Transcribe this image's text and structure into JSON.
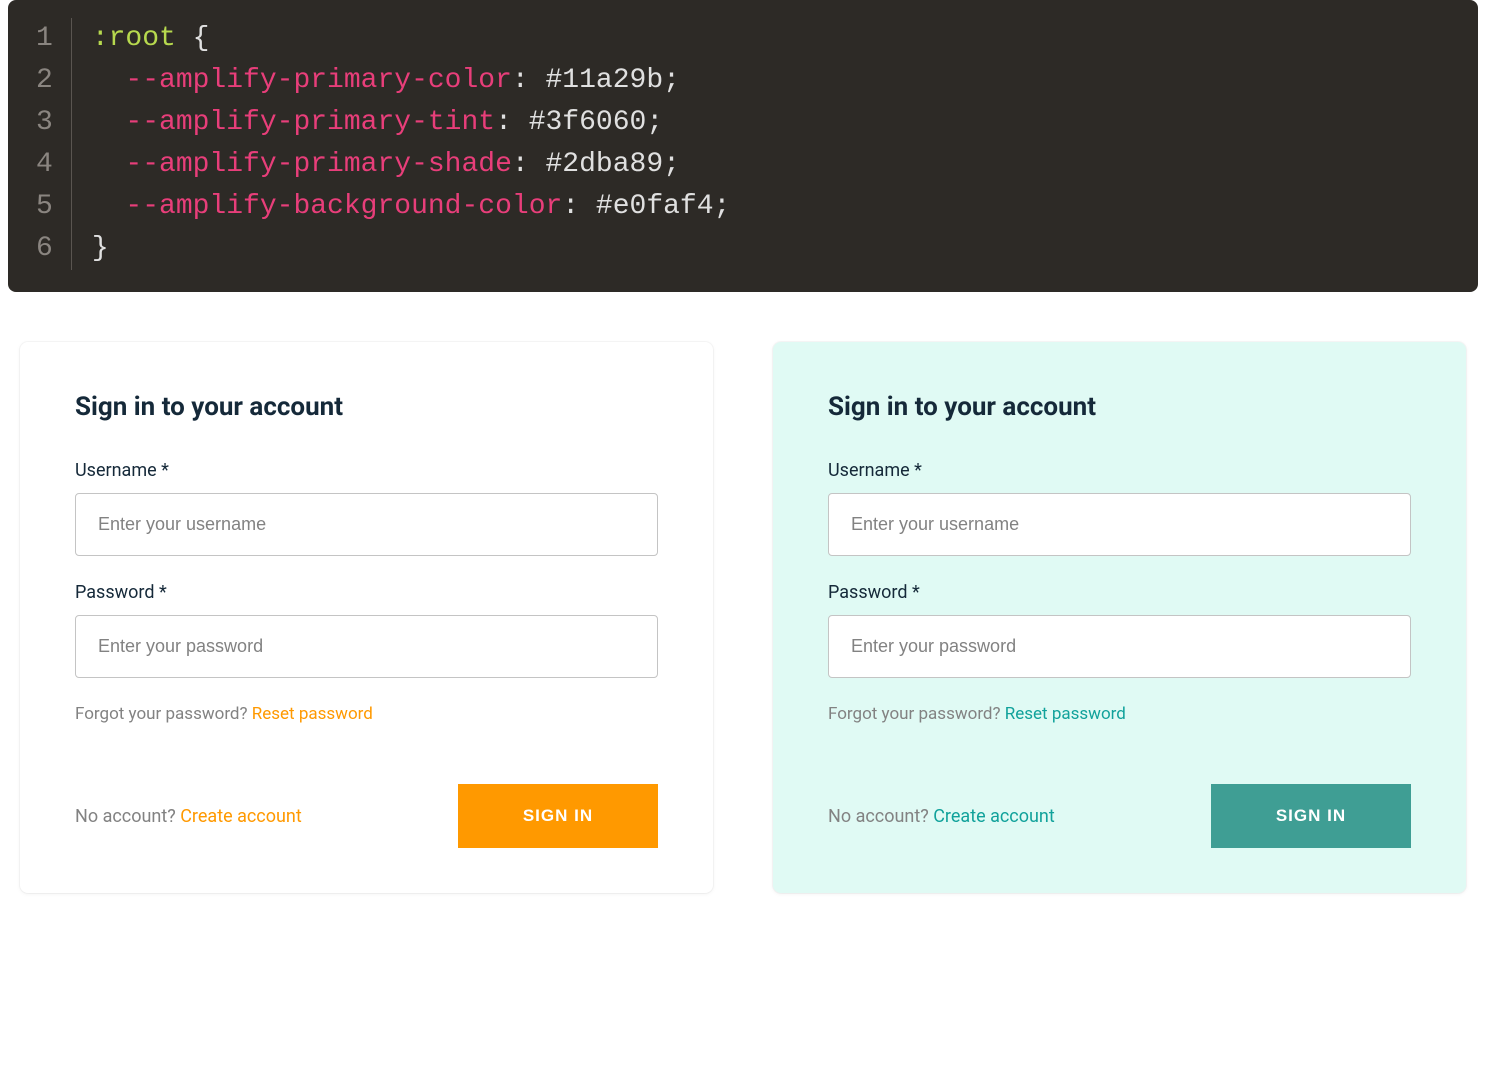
{
  "code": {
    "lines": [
      "1",
      "2",
      "3",
      "4",
      "5",
      "6"
    ],
    "selector": ":root",
    "open_brace": " {",
    "close_brace": "}",
    "props": [
      {
        "name": "--amplify-primary-color",
        "value": "#11a29b"
      },
      {
        "name": "--amplify-primary-tint",
        "value": "#3f6060"
      },
      {
        "name": "--amplify-primary-shade",
        "value": "#2dba89"
      },
      {
        "name": "--amplify-background-color",
        "value": "#e0faf4"
      }
    ],
    "colon_sep": ": ",
    "semicolon": ";"
  },
  "forms": {
    "default": {
      "title": "Sign in to your account",
      "username_label": "Username *",
      "username_placeholder": "Enter your username",
      "password_label": "Password *",
      "password_placeholder": "Enter your password",
      "forgot_text": "Forgot your password? ",
      "reset_link": "Reset password",
      "no_account_text": "No account? ",
      "create_link": "Create account",
      "signin_button": "SIGN IN"
    },
    "themed": {
      "title": "Sign in to your account",
      "username_label": "Username *",
      "username_placeholder": "Enter your username",
      "password_label": "Password *",
      "password_placeholder": "Enter your password",
      "forgot_text": "Forgot your password? ",
      "reset_link": "Reset password",
      "no_account_text": "No account? ",
      "create_link": "Create account",
      "signin_button": "SIGN IN"
    }
  },
  "colors": {
    "default_primary": "#ff9900",
    "themed_primary": "#11a29b",
    "themed_background": "#e0faf4",
    "code_bg": "#2d2a26"
  }
}
